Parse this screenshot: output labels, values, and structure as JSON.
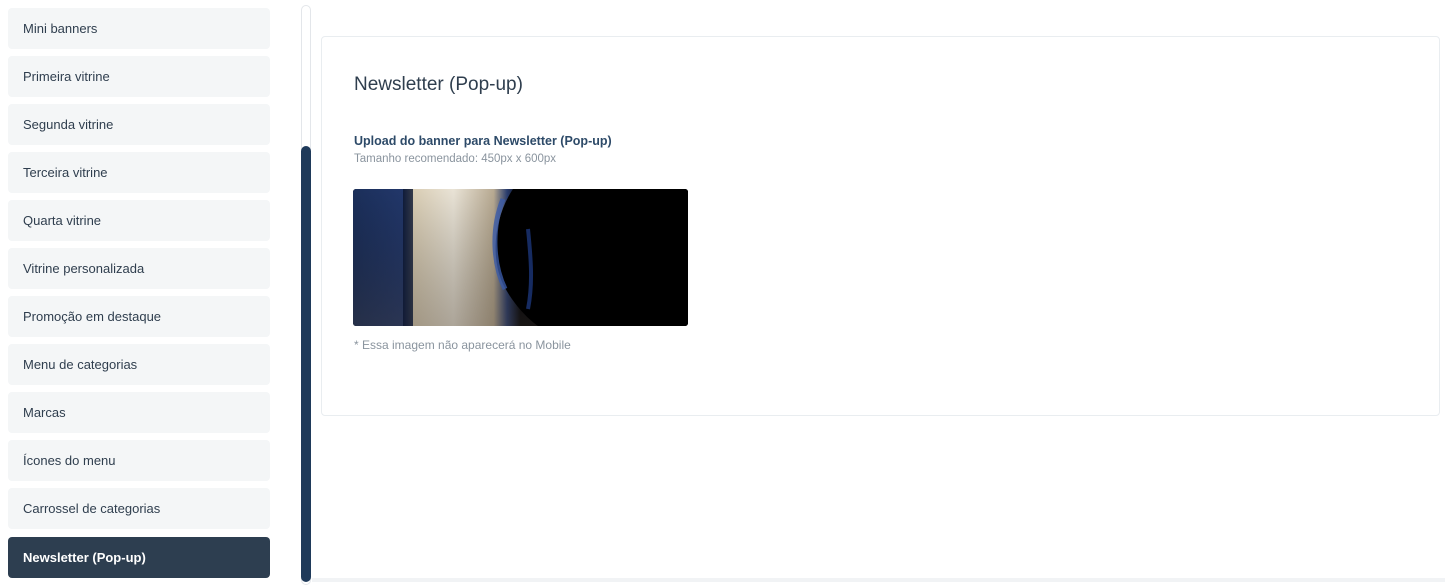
{
  "sidebar": {
    "items": [
      {
        "label": "Mini banners"
      },
      {
        "label": "Primeira vitrine"
      },
      {
        "label": "Segunda vitrine"
      },
      {
        "label": "Terceira vitrine"
      },
      {
        "label": "Quarta vitrine"
      },
      {
        "label": "Vitrine personalizada"
      },
      {
        "label": "Promoção em destaque"
      },
      {
        "label": "Menu de categorias"
      },
      {
        "label": "Marcas"
      },
      {
        "label": "Ícones do menu"
      },
      {
        "label": "Carrossel de categorias"
      },
      {
        "label": "Newsletter (Pop-up)"
      }
    ],
    "active_index": 11
  },
  "card": {
    "title": "Newsletter (Pop-up)",
    "upload_label": "Upload do banner para Newsletter (Pop-up)",
    "upload_hint": "Tamanho recomendado: 450px x 600px",
    "mobile_note": "* Essa imagem não aparecerá no Mobile"
  },
  "colors": {
    "active_item": "#2d3e50",
    "item_bg": "#f4f6f7",
    "scroll_thumb": "#1f3a5a"
  }
}
